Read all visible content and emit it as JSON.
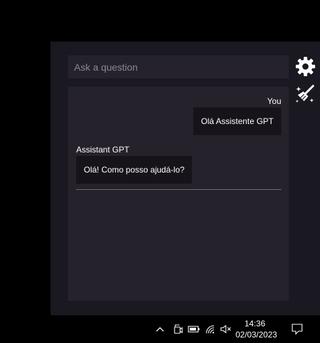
{
  "search": {
    "placeholder": "Ask a question"
  },
  "toolbar": {
    "settings_icon": "gear-icon",
    "clear_icon": "broom-icon"
  },
  "chat": {
    "user": {
      "label": "You",
      "message": "Olá Assistente GPT"
    },
    "assistant": {
      "label": "Assistant GPT",
      "message": "Olá! Como posso ajudá-lo?"
    }
  },
  "taskbar": {
    "icons": [
      "chevron-up-icon",
      "meet-now-icon",
      "battery-icon",
      "wifi-icon",
      "volume-muted-icon",
      "notifications-icon"
    ],
    "time": "14:36",
    "date": "02/03/2023"
  },
  "colors": {
    "panel_bg": "#1a1820",
    "input_bg": "#25222b",
    "bubble_bg": "#16141a"
  }
}
